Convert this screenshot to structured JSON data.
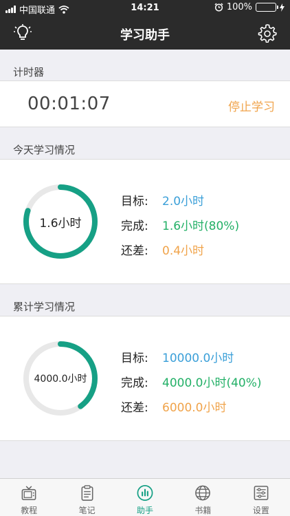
{
  "status_bar": {
    "carrier": "中国联通",
    "time": "14:21",
    "battery_text": "100%"
  },
  "navbar": {
    "title": "学习助手",
    "left_icon": "bulb-icon",
    "right_icon": "gear-icon"
  },
  "timer_section": {
    "header": "计时器",
    "elapsed": "00:01:07",
    "stop_label": "停止学习"
  },
  "today_section": {
    "header": "今天学习情况",
    "ring_label": "1.6小时",
    "progress": 0.8,
    "rows": [
      {
        "key": "目标:",
        "value": "2.0小时",
        "color": "#3a9fd8"
      },
      {
        "key": "完成:",
        "value": "1.6小时(80%)",
        "color": "#23b067"
      },
      {
        "key": "还差:",
        "value": "0.4小时",
        "color": "#f0a34a"
      }
    ]
  },
  "total_section": {
    "header": "累计学习情况",
    "ring_label": "4000.0小时",
    "progress": 0.4,
    "rows": [
      {
        "key": "目标:",
        "value": "10000.0小时",
        "color": "#3a9fd8"
      },
      {
        "key": "完成:",
        "value": "4000.0小时(40%)",
        "color": "#23b067"
      },
      {
        "key": "还差:",
        "value": "6000.0小时",
        "color": "#f0a34a"
      }
    ]
  },
  "tabbar": {
    "items": [
      {
        "label": "教程",
        "icon": "tv-icon"
      },
      {
        "label": "笔记",
        "icon": "clipboard-icon"
      },
      {
        "label": "助手",
        "icon": "chart-icon",
        "active": true
      },
      {
        "label": "书籍",
        "icon": "globe-icon"
      },
      {
        "label": "设置",
        "icon": "sliders-icon"
      }
    ]
  },
  "colors": {
    "accent": "#16a085",
    "ring_track": "#e8e8e8",
    "top_bar": "#2b2b2b"
  }
}
